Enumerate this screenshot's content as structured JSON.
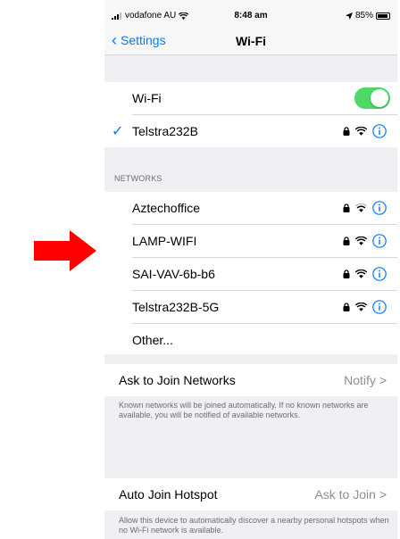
{
  "status_bar": {
    "carrier": "vodafone AU",
    "time": "8:48 am",
    "battery": "85%"
  },
  "nav": {
    "back_label": "Settings",
    "title": "Wi-Fi"
  },
  "wifi": {
    "label": "Wi-Fi",
    "enabled": true
  },
  "connected": {
    "name": "Telstra232B"
  },
  "networks": {
    "header": "NETWORKS",
    "items": [
      {
        "name": "Aztechoffice"
      },
      {
        "name": "LAMP-WIFI"
      },
      {
        "name": "SAI-VAV-6b-b6"
      },
      {
        "name": "Telstra232B-5G"
      }
    ],
    "other_label": "Other..."
  },
  "ask_to_join": {
    "label": "Ask to Join Networks",
    "value": "Notify",
    "description": "Known networks will be joined automatically. If no known networks are available, you will be notified of available networks."
  },
  "auto_join_hotspot": {
    "label": "Auto Join Hotspot",
    "value": "Ask to Join",
    "description": "Allow this device to automatically discover a nearby personal hotspots when no Wi-Fi network is available."
  },
  "colors": {
    "accent": "#007aff",
    "toggle_on": "#4cd964",
    "arrow": "#ff0000"
  }
}
